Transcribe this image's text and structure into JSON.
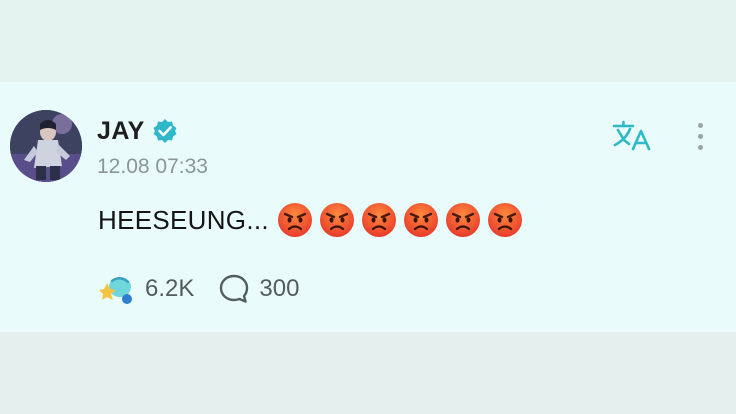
{
  "post": {
    "author": "JAY",
    "verified": true,
    "timestamp": "12.08 07:33",
    "text": "HEESEUNG...",
    "emoji_count": 6,
    "emoji_icon": "angry-face-icon",
    "like_count": "6.2K",
    "comment_count": "300"
  },
  "toolbar": {
    "translate_icon": "translate-icon",
    "more_icon": "more-vertical-icon"
  },
  "colors": {
    "card_background": "#e9fbfa",
    "accent": "#2fb8c8",
    "verified_badge": "#2fb8c8"
  }
}
